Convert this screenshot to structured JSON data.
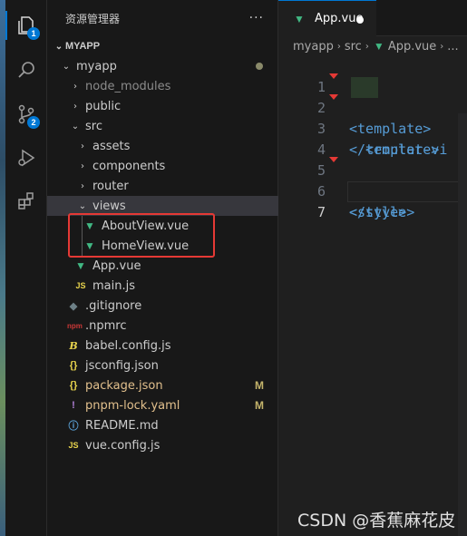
{
  "explorer": {
    "title": "资源管理器",
    "more": "···",
    "section": "MYAPP",
    "items": [
      {
        "label": "myapp",
        "status": ""
      },
      {
        "label": "node_modules",
        "status": ""
      },
      {
        "label": "public",
        "status": ""
      },
      {
        "label": "src",
        "status": ""
      },
      {
        "label": "assets",
        "status": ""
      },
      {
        "label": "components",
        "status": ""
      },
      {
        "label": "router",
        "status": ""
      },
      {
        "label": "views",
        "status": ""
      },
      {
        "label": "AboutView.vue",
        "status": ""
      },
      {
        "label": "HomeView.vue",
        "status": ""
      },
      {
        "label": "App.vue",
        "status": ""
      },
      {
        "label": "main.js",
        "status": ""
      },
      {
        "label": ".gitignore",
        "status": ""
      },
      {
        "label": ".npmrc",
        "status": ""
      },
      {
        "label": "babel.config.js",
        "status": ""
      },
      {
        "label": "jsconfig.json",
        "status": ""
      },
      {
        "label": "package.json",
        "status": "M"
      },
      {
        "label": "pnpm-lock.yaml",
        "status": "M"
      },
      {
        "label": "README.md",
        "status": ""
      },
      {
        "label": "vue.config.js",
        "status": ""
      }
    ]
  },
  "activity": {
    "explorer_badge": "1",
    "scm_badge": "2"
  },
  "editor": {
    "tab_label": "App.vue",
    "breadcrumb": [
      "myapp",
      "src",
      "App.vue",
      "..."
    ],
    "lines": [
      {
        "num": "1",
        "text": "<template>"
      },
      {
        "num": "2",
        "text": "  <router-vi"
      },
      {
        "num": "3",
        "text": "</template>"
      },
      {
        "num": "4",
        "text": ""
      },
      {
        "num": "5",
        "text": "<style>"
      },
      {
        "num": "6",
        "text": "</style>"
      },
      {
        "num": "7",
        "text": ""
      }
    ]
  },
  "watermark": "CSDN @香蕉麻花皮",
  "colors": {
    "accent": "#0078d4",
    "vue_green": "#41b883",
    "highlight_red": "#e53935",
    "tag_blue": "#569cd6"
  }
}
